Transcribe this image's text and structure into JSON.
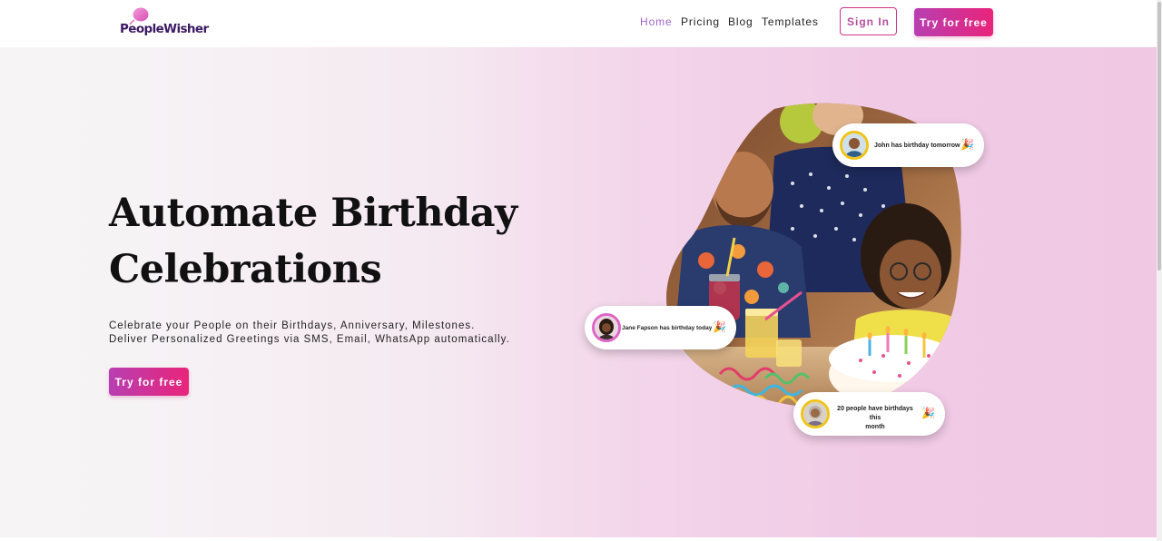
{
  "brand": {
    "name": "PeopleWisher",
    "logo_icon": "balloon-icon",
    "colors": {
      "primary_purple": "#3b1a63",
      "accent_pink": "#e9247a",
      "accent_magenta": "#b83fb2",
      "nav_active": "#a064c8"
    }
  },
  "nav": {
    "links": [
      {
        "label": "Home",
        "active": true
      },
      {
        "label": "Pricing",
        "active": false
      },
      {
        "label": "Blog",
        "active": false
      },
      {
        "label": "Templates",
        "active": false
      }
    ],
    "signin_label": "Sign In",
    "try_label": "Try for free"
  },
  "hero": {
    "title_line1": "Automate Birthday",
    "title_line2": "Celebrations",
    "subtitle_line1": "Celebrate your People on their Birthdays, Anniversary, Milestones.",
    "subtitle_line2": "Deliver Personalized Greetings via SMS, Email, WhatsApp automatically.",
    "cta_label": "Try for free",
    "image_icon": "birthday-party-photo"
  },
  "notifications": [
    {
      "text": "John has birthday tomorrow",
      "icon": "party-popper-icon"
    },
    {
      "text": "Jane Fapson has birthday today",
      "icon": "party-popper-icon"
    },
    {
      "text_line1": "20 people have birthdays this",
      "text_line2": "month",
      "icon": "party-popper-icon"
    }
  ]
}
